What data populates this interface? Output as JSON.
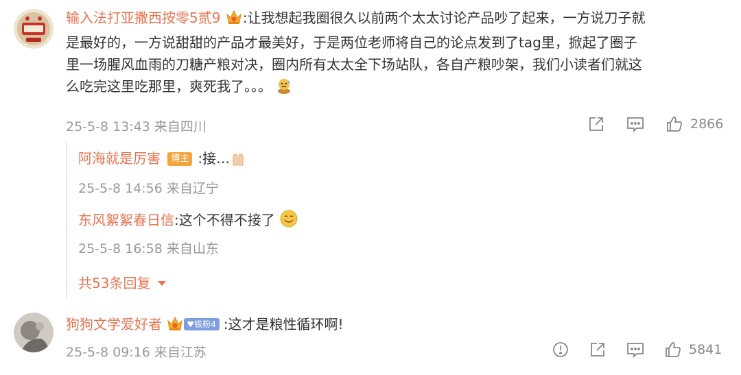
{
  "comments": [
    {
      "username": "输入法打亚撒西按零5贰9",
      "text_line1": ":让我想起我圈很久以前两个太太讨论产品吵了起来，一方说刀子就",
      "text_line2": "是最好的，一方说甜甜的产品才最美好，于是两位老师将自己的论点发到了tag里，掀起了圈子",
      "text_line3": "里一场腥风血雨的刀糖产粮对决，圈内所有太太全下场站队，各自产粮吵架，我们小读者们就这",
      "text_line4": "么吃完这里吃那里，爽死我了。。。",
      "timestamp": "25-5-8 13:43 来自四川",
      "like_count": "2866",
      "icons": [
        "vip-crown-icon",
        "sweat-emoji-icon",
        "share-icon",
        "comment-icon",
        "like-icon"
      ],
      "replies": [
        {
          "username": "阿海就是厉害",
          "badge": "博主",
          "text": ":接…",
          "timestamp": "25-5-8 14:56 来自辽宁"
        },
        {
          "username": "东风絮絮春日信",
          "text": ":这个不得不接了",
          "timestamp": "25-5-8 16:58 来自山东"
        }
      ],
      "more_replies_label": "共53条回复"
    },
    {
      "username": "狗狗文学爱好者",
      "fan_badge": "铁粉4",
      "text": ":这才是粮性循环啊!",
      "timestamp": "25-5-8 09:16 来自江苏",
      "like_count": "5841",
      "icons": [
        "report-icon",
        "share-icon",
        "comment-icon",
        "like-icon"
      ]
    }
  ],
  "colors": {
    "username": "#eb7350",
    "text": "#333333",
    "meta": "#999999",
    "host_badge": "#f5a43b",
    "fan_badge": "#7e9ee0"
  }
}
